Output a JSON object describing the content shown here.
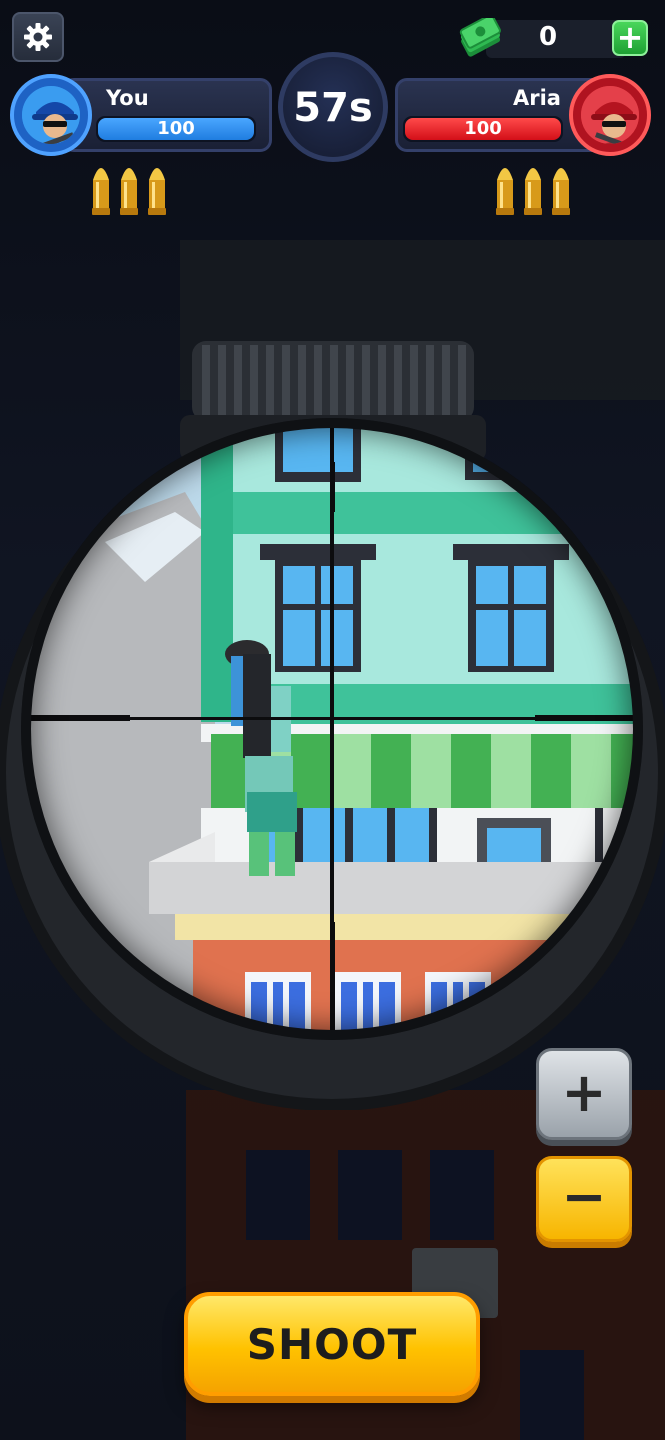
{
  "hud": {
    "cash": "0",
    "timer": "57s",
    "player": {
      "name": "You",
      "hp": "100",
      "hp_fraction": 1.0,
      "hp_color": "#1f7de0",
      "ammo": 3
    },
    "opponent": {
      "name": "Aria",
      "hp": "100",
      "hp_fraction": 1.0,
      "hp_color": "#e0141f",
      "ammo": 3
    }
  },
  "controls": {
    "zoom_in": "+",
    "zoom_out": "−",
    "shoot": "SHOOT"
  },
  "icons": {
    "settings": "gear-icon",
    "cash": "cash-stack-icon",
    "add_cash": "plus-icon",
    "player_avatar": "blue-soldier-avatar",
    "opponent_avatar": "red-soldier-avatar",
    "ammo": "bullet-icon",
    "scope": "sniper-scope-view"
  },
  "colors": {
    "accent_yellow": "#ffc200",
    "player_blue": "#1f7de0",
    "opponent_red": "#e0141f",
    "add_green": "#2dbb40"
  }
}
